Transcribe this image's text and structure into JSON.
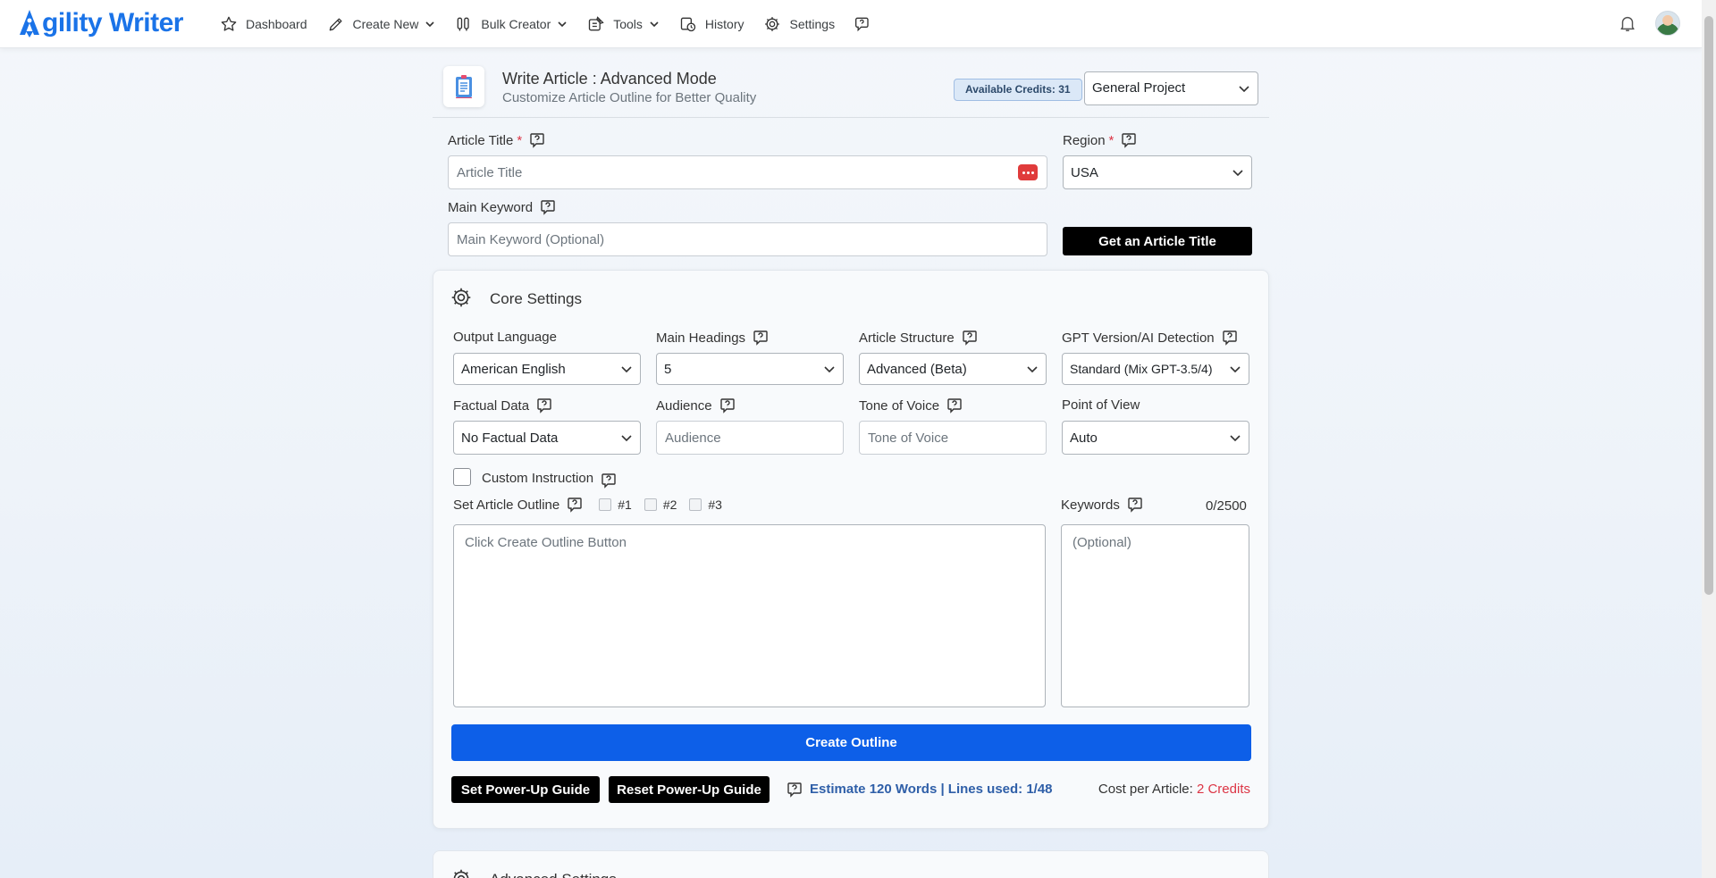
{
  "brand": {
    "name": "gility Writer",
    "color": "#1a73e8"
  },
  "nav": {
    "items": [
      {
        "label": "Dashboard",
        "icon": "star-icon"
      },
      {
        "label": "Create New",
        "icon": "pencil-icon",
        "dropdown": true
      },
      {
        "label": "Bulk Creator",
        "icon": "bulk-icon",
        "dropdown": true
      },
      {
        "label": "Tools",
        "icon": "tools-icon",
        "dropdown": true
      },
      {
        "label": "History",
        "icon": "history-icon"
      },
      {
        "label": "Settings",
        "icon": "gear-icon"
      },
      {
        "label": "",
        "icon": "help-chat-icon"
      }
    ]
  },
  "header": {
    "title": "Write Article : Advanced Mode",
    "subtitle": "Customize Article Outline for Better Quality",
    "credits": "Available Credits: 31",
    "project": "General Project"
  },
  "form": {
    "title_label": "Article Title",
    "title_placeholder": "Article Title",
    "required_mark": "*",
    "region_label": "Region",
    "region_value": "USA",
    "keyword_label": "Main Keyword",
    "keyword_placeholder": "Main Keyword (Optional)",
    "get_title_button": "Get an Article Title"
  },
  "core": {
    "title": "Core Settings",
    "output_language": {
      "label": "Output Language",
      "value": "American English"
    },
    "main_headings": {
      "label": "Main Headings",
      "value": "5"
    },
    "article_structure": {
      "label": "Article Structure",
      "value": "Advanced (Beta)"
    },
    "gpt_version": {
      "label": "GPT Version/AI Detection",
      "value": "Standard (Mix GPT-3.5/4)"
    },
    "factual_data": {
      "label": "Factual Data",
      "value": "No Factual Data"
    },
    "audience": {
      "label": "Audience",
      "placeholder": "Audience"
    },
    "tone": {
      "label": "Tone of Voice",
      "placeholder": "Tone of Voice"
    },
    "pov": {
      "label": "Point of View",
      "value": "Auto"
    },
    "custom_instruction": "Custom Instruction",
    "outline_label": "Set Article Outline",
    "outline_options": [
      "#1",
      "#2",
      "#3"
    ],
    "outline_placeholder": "Click Create Outline Button",
    "keywords_label": "Keywords",
    "keywords_count": "0/2500",
    "keywords_placeholder": "(Optional)",
    "create_outline_button": "Create Outline",
    "set_guide_button": "Set Power-Up Guide",
    "reset_guide_button": "Reset Power-Up Guide",
    "estimate": "Estimate 120 Words | Lines used: 1/48",
    "cost_label": "Cost per Article:",
    "cost_value": "2 Credits"
  },
  "advanced": {
    "title": "Advanced Settings"
  },
  "colors": {
    "primary": "#0d5fe8",
    "danger": "#dc3545",
    "dark": "#000000"
  }
}
